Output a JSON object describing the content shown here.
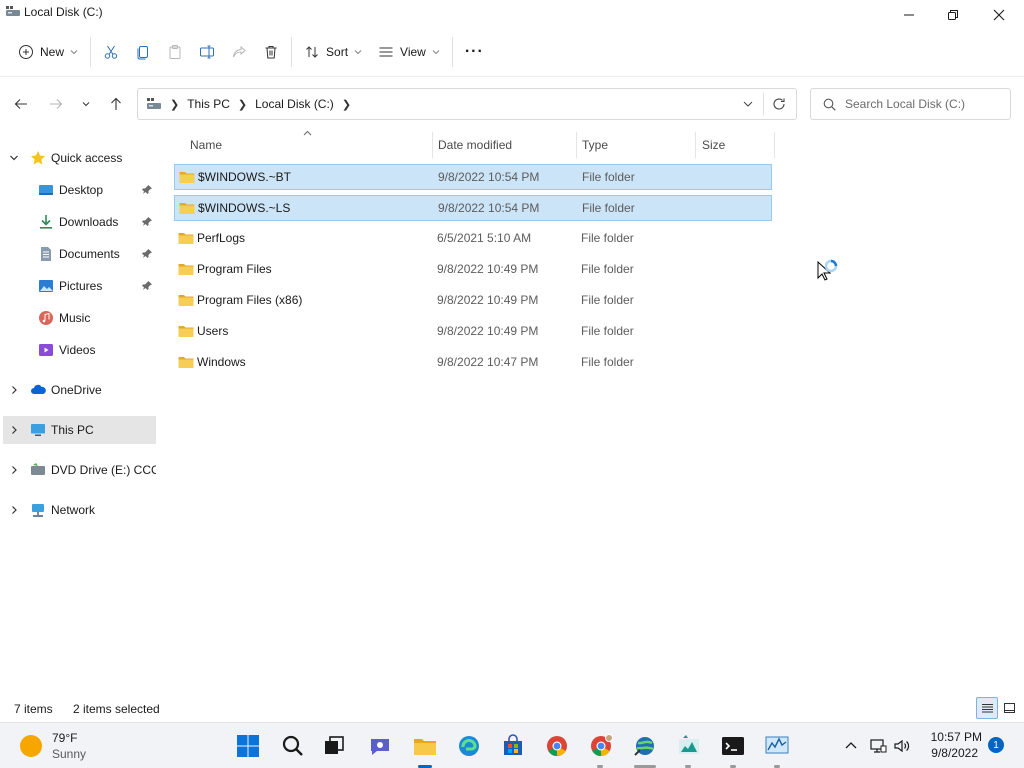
{
  "window": {
    "title": "Local Disk (C:)"
  },
  "toolbar": {
    "new_label": "New",
    "sort_label": "Sort",
    "view_label": "View",
    "more_label": "···"
  },
  "address": {
    "crumbs": [
      "This PC",
      "Local Disk (C:)"
    ],
    "search_placeholder": "Search Local Disk (C:)"
  },
  "nav": {
    "quick_access": "Quick access",
    "pinned": [
      {
        "label": "Desktop",
        "icon": "desktop-icon",
        "pinned": true
      },
      {
        "label": "Downloads",
        "icon": "downloads-icon",
        "pinned": true
      },
      {
        "label": "Documents",
        "icon": "documents-icon",
        "pinned": true
      },
      {
        "label": "Pictures",
        "icon": "pictures-icon",
        "pinned": true
      },
      {
        "label": "Music",
        "icon": "music-icon",
        "pinned": false
      },
      {
        "label": "Videos",
        "icon": "videos-icon",
        "pinned": false
      }
    ],
    "onedrive": "OneDrive",
    "this_pc": "This PC",
    "dvd": "DVD Drive (E:) CCCC",
    "network": "Network",
    "selected": "This PC"
  },
  "columns": {
    "name": "Name",
    "date": "Date modified",
    "type": "Type",
    "size": "Size"
  },
  "files": [
    {
      "name": "$WINDOWS.~BT",
      "date": "9/8/2022 10:54 PM",
      "type": "File folder",
      "selected": true
    },
    {
      "name": "$WINDOWS.~LS",
      "date": "9/8/2022 10:54 PM",
      "type": "File folder",
      "selected": true
    },
    {
      "name": "PerfLogs",
      "date": "6/5/2021 5:10 AM",
      "type": "File folder",
      "selected": false
    },
    {
      "name": "Program Files",
      "date": "9/8/2022 10:49 PM",
      "type": "File folder",
      "selected": false
    },
    {
      "name": "Program Files (x86)",
      "date": "9/8/2022 10:49 PM",
      "type": "File folder",
      "selected": false
    },
    {
      "name": "Users",
      "date": "9/8/2022 10:49 PM",
      "type": "File folder",
      "selected": false
    },
    {
      "name": "Windows",
      "date": "9/8/2022 10:47 PM",
      "type": "File folder",
      "selected": false
    }
  ],
  "status": {
    "count": "7 items",
    "selected": "2 items selected"
  },
  "taskbar": {
    "weather_temp": "79°F",
    "weather_cond": "Sunny",
    "apps": [
      "start-icon",
      "search-icon",
      "task-view-icon",
      "chat-icon",
      "file-explorer-icon",
      "edge-icon",
      "store-icon",
      "chrome-icon",
      "chrome-profile-icon",
      "app-globe-icon",
      "app-chart-icon",
      "terminal-icon",
      "monitor-app-icon"
    ],
    "time": "10:57 PM",
    "date": "9/8/2022",
    "notifications": "1"
  },
  "colors": {
    "accent": "#0067c0",
    "selection": "#cce4f7",
    "selection_border": "#99c9ef",
    "folder": "#f3c24f"
  }
}
